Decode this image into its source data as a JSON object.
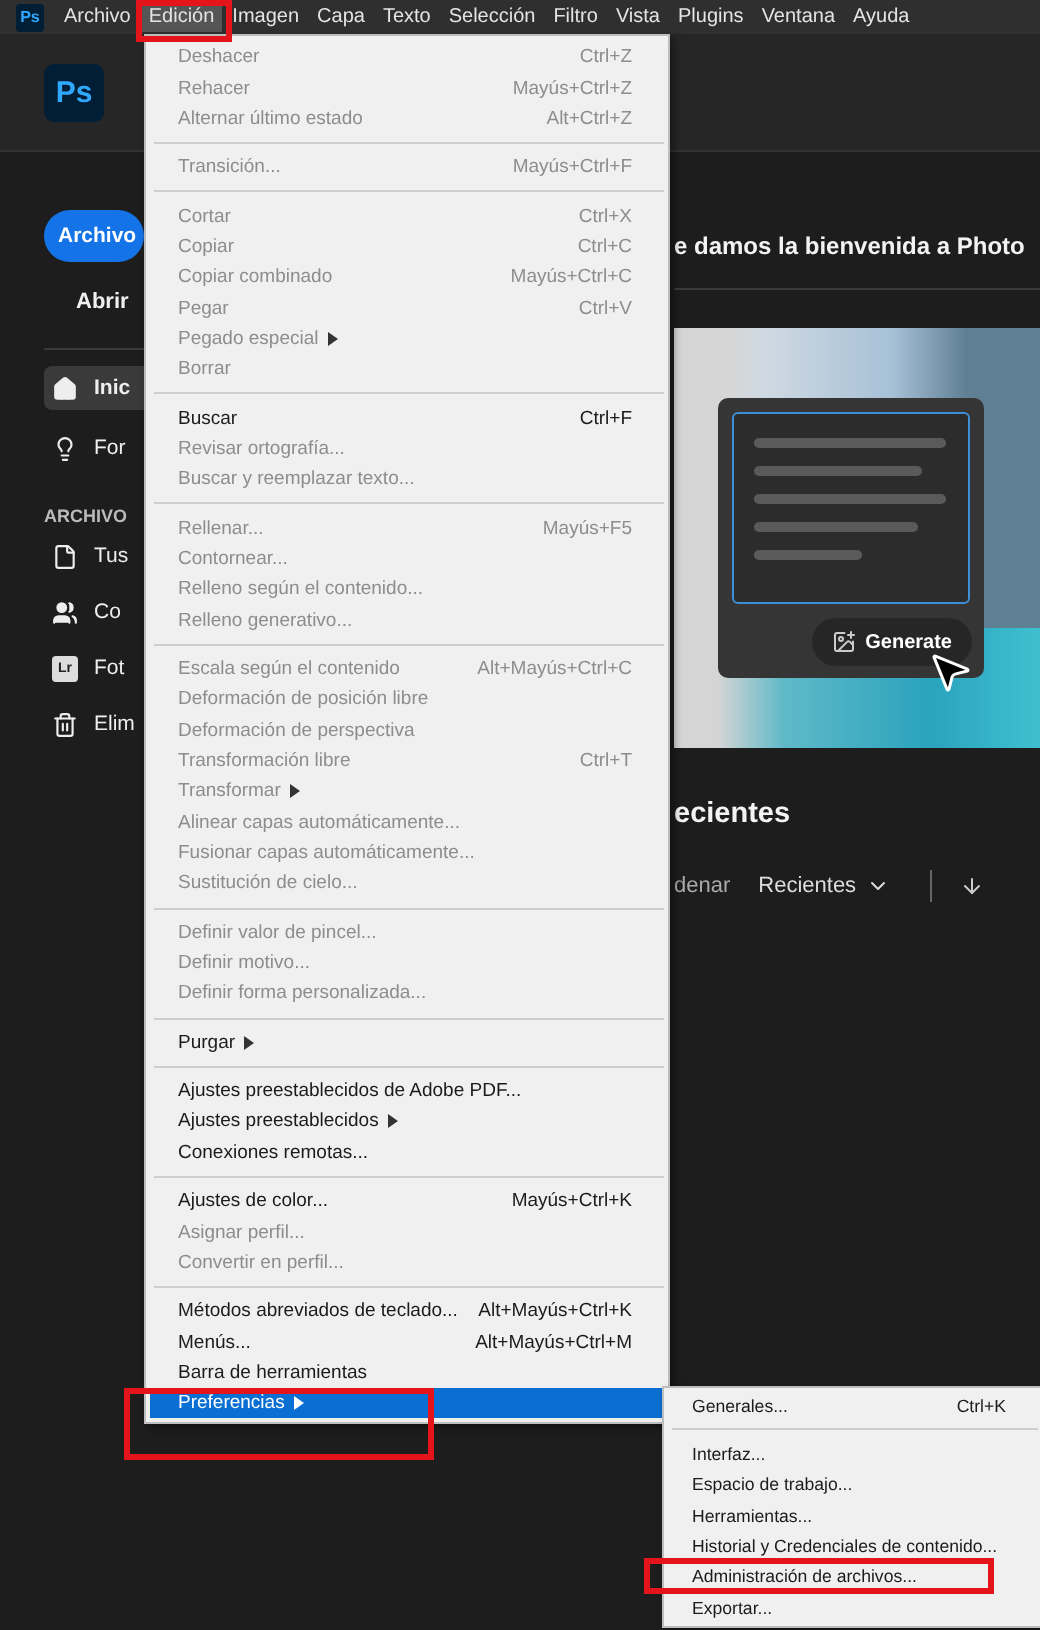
{
  "menubar": {
    "logo": "Ps",
    "items": [
      {
        "label": "Archivo",
        "selected": false
      },
      {
        "label": "Edición",
        "selected": true
      },
      {
        "label": "Imagen",
        "selected": false
      },
      {
        "label": "Capa",
        "selected": false
      },
      {
        "label": "Texto",
        "selected": false
      },
      {
        "label": "Selección",
        "selected": false
      },
      {
        "label": "Filtro",
        "selected": false
      },
      {
        "label": "Vista",
        "selected": false
      },
      {
        "label": "Plugins",
        "selected": false
      },
      {
        "label": "Ventana",
        "selected": false
      },
      {
        "label": "Ayuda",
        "selected": false
      }
    ]
  },
  "header": {
    "logo": "Ps"
  },
  "sidebar": {
    "primary_button": "Archivo",
    "open_link": "Abrir",
    "nav": [
      {
        "kind": "home",
        "label": "Inic",
        "selected": true
      },
      {
        "kind": "bulb",
        "label": "For",
        "selected": false
      }
    ],
    "section_title": "ARCHIVO",
    "files_nav": [
      {
        "kind": "file",
        "label": "Tus",
        "selected": false
      },
      {
        "kind": "people",
        "label": "Co",
        "selected": false
      },
      {
        "kind": "badge",
        "badge": "Lr",
        "label": "Fot",
        "selected": false
      },
      {
        "kind": "trash",
        "label": "Elim",
        "selected": false
      }
    ]
  },
  "main": {
    "welcome": "e damos la bienvenida a Photo",
    "promo": {
      "button": "Generate"
    },
    "recent_title": "ecientes",
    "toolbar": {
      "sort_label": "denar",
      "sort_value": "Recientes"
    }
  },
  "edit_menu": {
    "sections": [
      {
        "items": [
          {
            "label": "Deshacer",
            "shortcut": "Ctrl+Z",
            "disabled": true,
            "submenu": false,
            "selected": false
          },
          {
            "label": "Rehacer",
            "shortcut": "Mayús+Ctrl+Z",
            "disabled": true,
            "submenu": false,
            "selected": false
          },
          {
            "label": "Alternar último estado",
            "shortcut": "Alt+Ctrl+Z",
            "disabled": true,
            "submenu": false,
            "selected": false
          }
        ]
      },
      {
        "items": [
          {
            "label": "Transición...",
            "shortcut": "Mayús+Ctrl+F",
            "disabled": true,
            "submenu": false,
            "selected": false
          }
        ]
      },
      {
        "items": [
          {
            "label": "Cortar",
            "shortcut": "Ctrl+X",
            "disabled": true,
            "submenu": false,
            "selected": false
          },
          {
            "label": "Copiar",
            "shortcut": "Ctrl+C",
            "disabled": true,
            "submenu": false,
            "selected": false
          },
          {
            "label": "Copiar combinado",
            "shortcut": "Mayús+Ctrl+C",
            "disabled": true,
            "submenu": false,
            "selected": false
          },
          {
            "label": "Pegar",
            "shortcut": "Ctrl+V",
            "disabled": true,
            "submenu": false,
            "selected": false
          },
          {
            "label": "Pegado especial",
            "disabled": true,
            "submenu": true,
            "selected": false
          },
          {
            "label": "Borrar",
            "disabled": true,
            "submenu": false,
            "selected": false
          }
        ]
      },
      {
        "items": [
          {
            "label": "Buscar",
            "shortcut": "Ctrl+F",
            "disabled": false,
            "submenu": false,
            "selected": false
          },
          {
            "label": "Revisar ortografía...",
            "disabled": true,
            "submenu": false,
            "selected": false
          },
          {
            "label": "Buscar y reemplazar texto...",
            "disabled": true,
            "submenu": false,
            "selected": false
          }
        ]
      },
      {
        "items": [
          {
            "label": "Rellenar...",
            "shortcut": "Mayús+F5",
            "disabled": true,
            "submenu": false,
            "selected": false
          },
          {
            "label": "Contornear...",
            "disabled": true,
            "submenu": false,
            "selected": false
          },
          {
            "label": "Relleno según el contenido...",
            "disabled": true,
            "submenu": false,
            "selected": false
          },
          {
            "label": "Relleno generativo...",
            "disabled": true,
            "submenu": false,
            "selected": false
          }
        ]
      },
      {
        "items": [
          {
            "label": "Escala según el contenido",
            "shortcut": "Alt+Mayús+Ctrl+C",
            "disabled": true,
            "submenu": false,
            "selected": false
          },
          {
            "label": "Deformación de posición libre",
            "disabled": true,
            "submenu": false,
            "selected": false
          },
          {
            "label": "Deformación de perspectiva",
            "disabled": true,
            "submenu": false,
            "selected": false
          },
          {
            "label": "Transformación libre",
            "shortcut": "Ctrl+T",
            "disabled": true,
            "submenu": false,
            "selected": false
          },
          {
            "label": "Transformar",
            "disabled": true,
            "submenu": true,
            "selected": false
          },
          {
            "label": "Alinear capas automáticamente...",
            "disabled": true,
            "submenu": false,
            "selected": false
          },
          {
            "label": "Fusionar capas automáticamente...",
            "disabled": true,
            "submenu": false,
            "selected": false
          },
          {
            "label": "Sustitución de cielo...",
            "disabled": true,
            "submenu": false,
            "selected": false
          }
        ]
      },
      {
        "items": [
          {
            "label": "Definir valor de pincel...",
            "disabled": true,
            "submenu": false,
            "selected": false
          },
          {
            "label": "Definir motivo...",
            "disabled": true,
            "submenu": false,
            "selected": false
          },
          {
            "label": "Definir forma personalizada...",
            "disabled": true,
            "submenu": false,
            "selected": false
          }
        ]
      },
      {
        "items": [
          {
            "label": "Purgar",
            "disabled": false,
            "submenu": true,
            "selected": false
          }
        ]
      },
      {
        "items": [
          {
            "label": "Ajustes preestablecidos de Adobe PDF...",
            "disabled": false,
            "submenu": false,
            "selected": false
          },
          {
            "label": "Ajustes preestablecidos",
            "disabled": false,
            "submenu": true,
            "selected": false
          },
          {
            "label": "Conexiones remotas...",
            "disabled": false,
            "submenu": false,
            "selected": false
          }
        ]
      },
      {
        "items": [
          {
            "label": "Ajustes de color...",
            "shortcut": "Mayús+Ctrl+K",
            "disabled": false,
            "submenu": false,
            "selected": false
          },
          {
            "label": "Asignar perfil...",
            "disabled": true,
            "submenu": false,
            "selected": false
          },
          {
            "label": "Convertir en perfil...",
            "disabled": true,
            "submenu": false,
            "selected": false
          }
        ]
      },
      {
        "items": [
          {
            "label": "Métodos abreviados de teclado...",
            "shortcut": "Alt+Mayús+Ctrl+K",
            "disabled": false,
            "submenu": false,
            "selected": false
          },
          {
            "label": "Menús...",
            "shortcut": "Alt+Mayús+Ctrl+M",
            "disabled": false,
            "submenu": false,
            "selected": false
          },
          {
            "label": "Barra de herramientas",
            "disabled": false,
            "submenu": false,
            "selected": false
          },
          {
            "label": "Preferencias",
            "disabled": false,
            "submenu": true,
            "selected": true
          }
        ]
      }
    ]
  },
  "preferences_submenu": {
    "sections": [
      {
        "items": [
          {
            "label": "Generales...",
            "shortcut": "Ctrl+K",
            "disabled": false,
            "submenu": false,
            "selected": false
          }
        ]
      },
      {
        "items": [
          {
            "label": "Interfaz...",
            "disabled": false,
            "submenu": false,
            "selected": false
          },
          {
            "label": "Espacio de trabajo...",
            "disabled": false,
            "submenu": false,
            "selected": false
          },
          {
            "label": "Herramientas...",
            "disabled": false,
            "submenu": false,
            "selected": false
          },
          {
            "label": "Historial y Credenciales de contenido...",
            "disabled": false,
            "submenu": false,
            "selected": false
          },
          {
            "label": "Administración de archivos...",
            "disabled": false,
            "submenu": false,
            "selected": false
          },
          {
            "label": "Exportar...",
            "disabled": false,
            "submenu": false,
            "selected": false
          }
        ]
      }
    ]
  }
}
